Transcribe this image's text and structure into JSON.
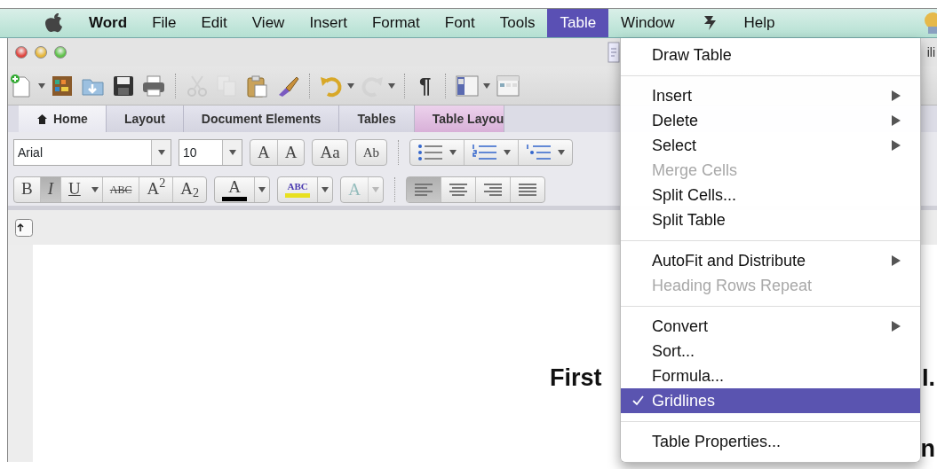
{
  "menu_bar": {
    "items": [
      {
        "kind": "apple"
      },
      {
        "kind": "app",
        "label": "Word",
        "selected": false
      },
      {
        "kind": "menu",
        "label": "File",
        "selected": false
      },
      {
        "kind": "menu",
        "label": "Edit",
        "selected": false
      },
      {
        "kind": "menu",
        "label": "View",
        "selected": false
      },
      {
        "kind": "menu",
        "label": "Insert",
        "selected": false
      },
      {
        "kind": "menu",
        "label": "Format",
        "selected": false
      },
      {
        "kind": "menu",
        "label": "Font",
        "selected": false
      },
      {
        "kind": "menu",
        "label": "Tools",
        "selected": false
      },
      {
        "kind": "menu",
        "label": "Table",
        "selected": true
      },
      {
        "kind": "menu",
        "label": "Window",
        "selected": false
      },
      {
        "kind": "script"
      },
      {
        "kind": "menu",
        "label": "Help",
        "selected": false
      },
      {
        "kind": "bulb"
      }
    ]
  },
  "window": {
    "title_fragment": "ili"
  },
  "toolbar": {
    "buttons": [
      {
        "kind": "new",
        "dropdown": true,
        "disabled": false
      },
      {
        "kind": "gallery",
        "dropdown": false,
        "disabled": false
      },
      {
        "kind": "open",
        "dropdown": false,
        "disabled": false
      },
      {
        "kind": "save",
        "dropdown": false,
        "disabled": false
      },
      {
        "kind": "print",
        "dropdown": false,
        "disabled": false
      },
      {
        "kind": "cut",
        "dropdown": false,
        "disabled": true
      },
      {
        "kind": "copy",
        "dropdown": false,
        "disabled": true
      },
      {
        "kind": "paste",
        "dropdown": false,
        "disabled": false
      },
      {
        "kind": "brush",
        "dropdown": false,
        "disabled": false
      },
      {
        "kind": "undo",
        "dropdown": true,
        "disabled": false
      },
      {
        "kind": "redo",
        "dropdown": true,
        "disabled": true
      },
      {
        "kind": "pilcrow",
        "label": "¶",
        "dropdown": false,
        "disabled": false
      },
      {
        "kind": "sidebar",
        "dropdown": true,
        "disabled": false
      },
      {
        "kind": "view",
        "dropdown": false,
        "disabled": false
      }
    ]
  },
  "ribbon_tabs": [
    {
      "label": "Home",
      "selected": true,
      "kind": "home"
    },
    {
      "label": "Layout",
      "selected": false,
      "kind": "plain"
    },
    {
      "label": "Document Elements",
      "selected": false,
      "kind": "plain"
    },
    {
      "label": "Tables",
      "selected": false,
      "kind": "plain"
    },
    {
      "label": "Table Layou",
      "selected": false,
      "kind": "contextual"
    }
  ],
  "font": {
    "name": "Arial",
    "size": "10"
  },
  "font_buttons": [
    {
      "kind": "grow",
      "label": "A"
    },
    {
      "kind": "shrink",
      "label": "A"
    },
    {
      "kind": "case",
      "label": "Aa"
    },
    {
      "kind": "clear",
      "label": "Ab"
    }
  ],
  "list_buttons": [
    {
      "kind": "bullets"
    },
    {
      "kind": "numbering"
    },
    {
      "kind": "multilevel"
    }
  ],
  "format_buttons": [
    {
      "kind": "bold",
      "label": "B",
      "selected": false
    },
    {
      "kind": "italic",
      "label": "I",
      "selected": true
    },
    {
      "kind": "underline",
      "label": "U",
      "selected": false
    },
    {
      "kind": "strike",
      "label": "ABC",
      "selected": false
    },
    {
      "kind": "sup",
      "label": "A$^{2}$",
      "selected": false
    },
    {
      "kind": "sub",
      "label": "A$_{2}$",
      "selected": false
    }
  ],
  "color_buttons": [
    {
      "kind": "font_color",
      "label": "A",
      "color": "#000000",
      "disabled": false
    },
    {
      "kind": "highlight",
      "label": "ABC",
      "color": "#e8e020",
      "disabled": false
    },
    {
      "kind": "effects",
      "label": "A",
      "disabled": true
    }
  ],
  "align_buttons": [
    {
      "kind": "left",
      "selected": true
    },
    {
      "kind": "center",
      "selected": false
    },
    {
      "kind": "right",
      "selected": false
    },
    {
      "kind": "justify",
      "selected": false
    }
  ],
  "document": {
    "heading": "First",
    "fragments": [
      "I.",
      "n"
    ]
  },
  "table_menu": {
    "groups": [
      [
        {
          "label": "Draw Table",
          "disabled": false,
          "submenu": false,
          "checked": false,
          "selected": false
        }
      ],
      [
        {
          "label": "Insert",
          "disabled": false,
          "submenu": true,
          "checked": false,
          "selected": false
        },
        {
          "label": "Delete",
          "disabled": false,
          "submenu": true,
          "checked": false,
          "selected": false
        },
        {
          "label": "Select",
          "disabled": false,
          "submenu": true,
          "checked": false,
          "selected": false
        },
        {
          "label": "Merge Cells",
          "disabled": true,
          "submenu": false,
          "checked": false,
          "selected": false
        },
        {
          "label": "Split Cells...",
          "disabled": false,
          "submenu": false,
          "checked": false,
          "selected": false
        },
        {
          "label": "Split Table",
          "disabled": false,
          "submenu": false,
          "checked": false,
          "selected": false
        }
      ],
      [
        {
          "label": "AutoFit and Distribute",
          "disabled": false,
          "submenu": true,
          "checked": false,
          "selected": false
        },
        {
          "label": "Heading Rows Repeat",
          "disabled": true,
          "submenu": false,
          "checked": false,
          "selected": false
        }
      ],
      [
        {
          "label": "Convert",
          "disabled": false,
          "submenu": true,
          "checked": false,
          "selected": false
        },
        {
          "label": "Sort...",
          "disabled": false,
          "submenu": false,
          "checked": false,
          "selected": false
        },
        {
          "label": "Formula...",
          "disabled": false,
          "submenu": false,
          "checked": false,
          "selected": false
        },
        {
          "label": "Gridlines",
          "disabled": false,
          "submenu": false,
          "checked": true,
          "selected": true
        }
      ],
      [
        {
          "label": "Table Properties...",
          "disabled": false,
          "submenu": false,
          "checked": false,
          "selected": false
        }
      ]
    ]
  }
}
